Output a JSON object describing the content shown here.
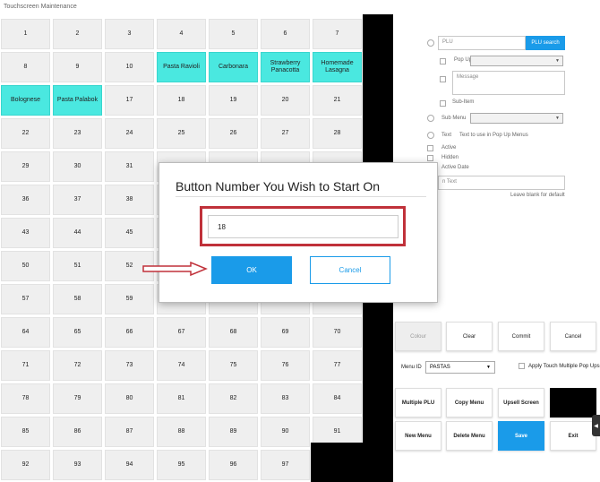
{
  "window": {
    "title": "Touchscreen Maintenance"
  },
  "grid": {
    "cells": [
      "1",
      "2",
      "3",
      "4",
      "5",
      "6",
      "7",
      "8",
      "9",
      "10",
      "Pasta Ravioli",
      "Carbonara",
      "Strawberry Panacotta",
      "Homemade Lasagna",
      "Bolognese",
      "Pasta Palabok",
      "17",
      "18",
      "19",
      "20",
      "21",
      "22",
      "23",
      "24",
      "25",
      "26",
      "27",
      "28",
      "29",
      "30",
      "31",
      "",
      "",
      "",
      "",
      "36",
      "37",
      "38",
      "",
      "",
      "",
      "",
      "43",
      "44",
      "45",
      "",
      "",
      "",
      "",
      "50",
      "51",
      "52",
      "",
      "",
      "",
      "",
      "57",
      "58",
      "59",
      "",
      "",
      "",
      "",
      "64",
      "65",
      "66",
      "67",
      "68",
      "69",
      "70",
      "71",
      "72",
      "73",
      "74",
      "75",
      "76",
      "77",
      "78",
      "79",
      "80",
      "81",
      "82",
      "83",
      "84",
      "85",
      "86",
      "87",
      "88",
      "89",
      "90",
      "91",
      "92",
      "93",
      "94",
      "95",
      "96",
      "97",
      ""
    ],
    "highlighted": [
      "Pasta Ravioli",
      "Carbonara",
      "Strawberry Panacotta",
      "Homemade Lasagna",
      "Bolognese",
      "Pasta Palabok"
    ],
    "highlight_color": "#4ae8e0"
  },
  "form": {
    "plu_placeholder": "PLU",
    "plu_search_label": "PLU search",
    "popup_label": "Pop Up",
    "message_placeholder": "Message",
    "subitem_label": "Sub-Item",
    "submenu_label": "Sub Menu",
    "text_label": "Text",
    "text_hint": "Text to use in Pop Up Menus",
    "active_label": "Active",
    "hidden_label": "Hidden",
    "active_date_label": "Active Date",
    "text_field_placeholder": "n Text",
    "leave_blank_hint": "Leave blank for default"
  },
  "actions": {
    "colour": "Colour",
    "clear": "Clear",
    "commit": "Commit",
    "cancel": "Cancel",
    "menu_id_label": "Menu ID",
    "menu_id_value": "PASTAS",
    "apply_touch_label": "Apply Touch Multiple Pop Ups",
    "multiple_plu": "Multiple PLU",
    "copy_menu": "Copy Menu",
    "upsell_screen": "Upsell Screen",
    "new_menu": "New Menu",
    "delete_menu": "Delete Menu",
    "save": "Save",
    "exit": "Exit"
  },
  "dialog": {
    "title": "Button Number You Wish to Start On",
    "input_value": "18",
    "ok_label": "OK",
    "cancel_label": "Cancel"
  },
  "colors": {
    "accent": "#1a9be9",
    "highlight_outline": "#c0313a"
  }
}
